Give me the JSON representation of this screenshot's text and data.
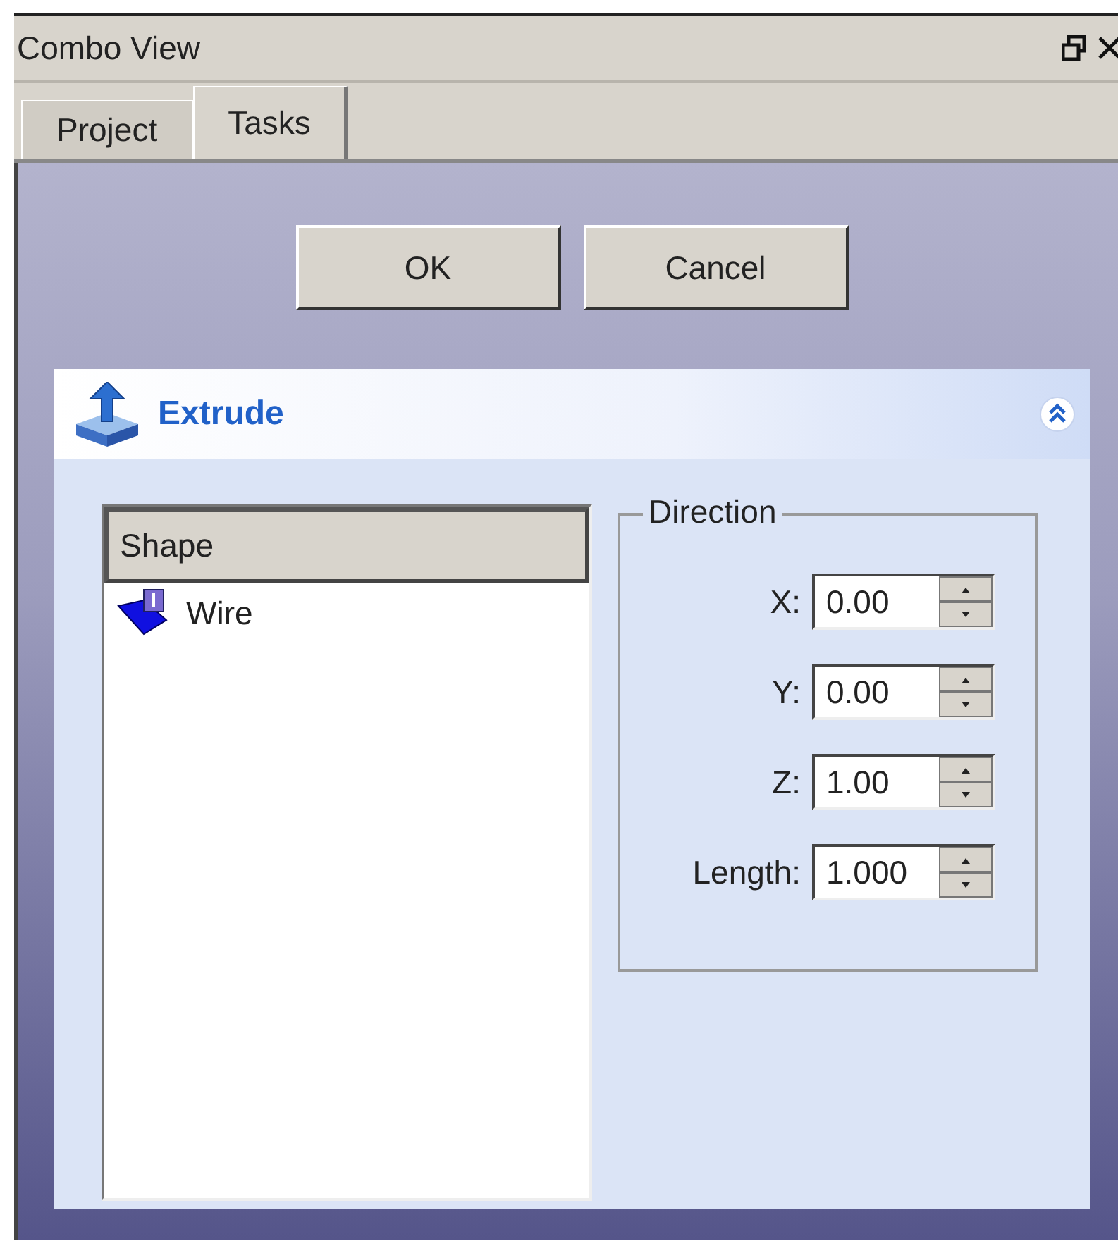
{
  "window": {
    "title": "Combo View"
  },
  "tabs": [
    {
      "label": "Project",
      "selected": false
    },
    {
      "label": "Tasks",
      "selected": true
    }
  ],
  "buttons": [
    "OK",
    "Cancel"
  ],
  "task_panel": {
    "title": "Extrude",
    "expanded": true
  },
  "shape_list": {
    "header": "Shape",
    "items": [
      {
        "label": "Wire"
      }
    ]
  },
  "direction": {
    "title": "Direction",
    "fields": [
      {
        "label": "X:",
        "value": "0.00"
      },
      {
        "label": "Y:",
        "value": "0.00"
      },
      {
        "label": "Z:",
        "value": "1.00"
      },
      {
        "label": "Length:",
        "value": "1.000"
      }
    ]
  }
}
